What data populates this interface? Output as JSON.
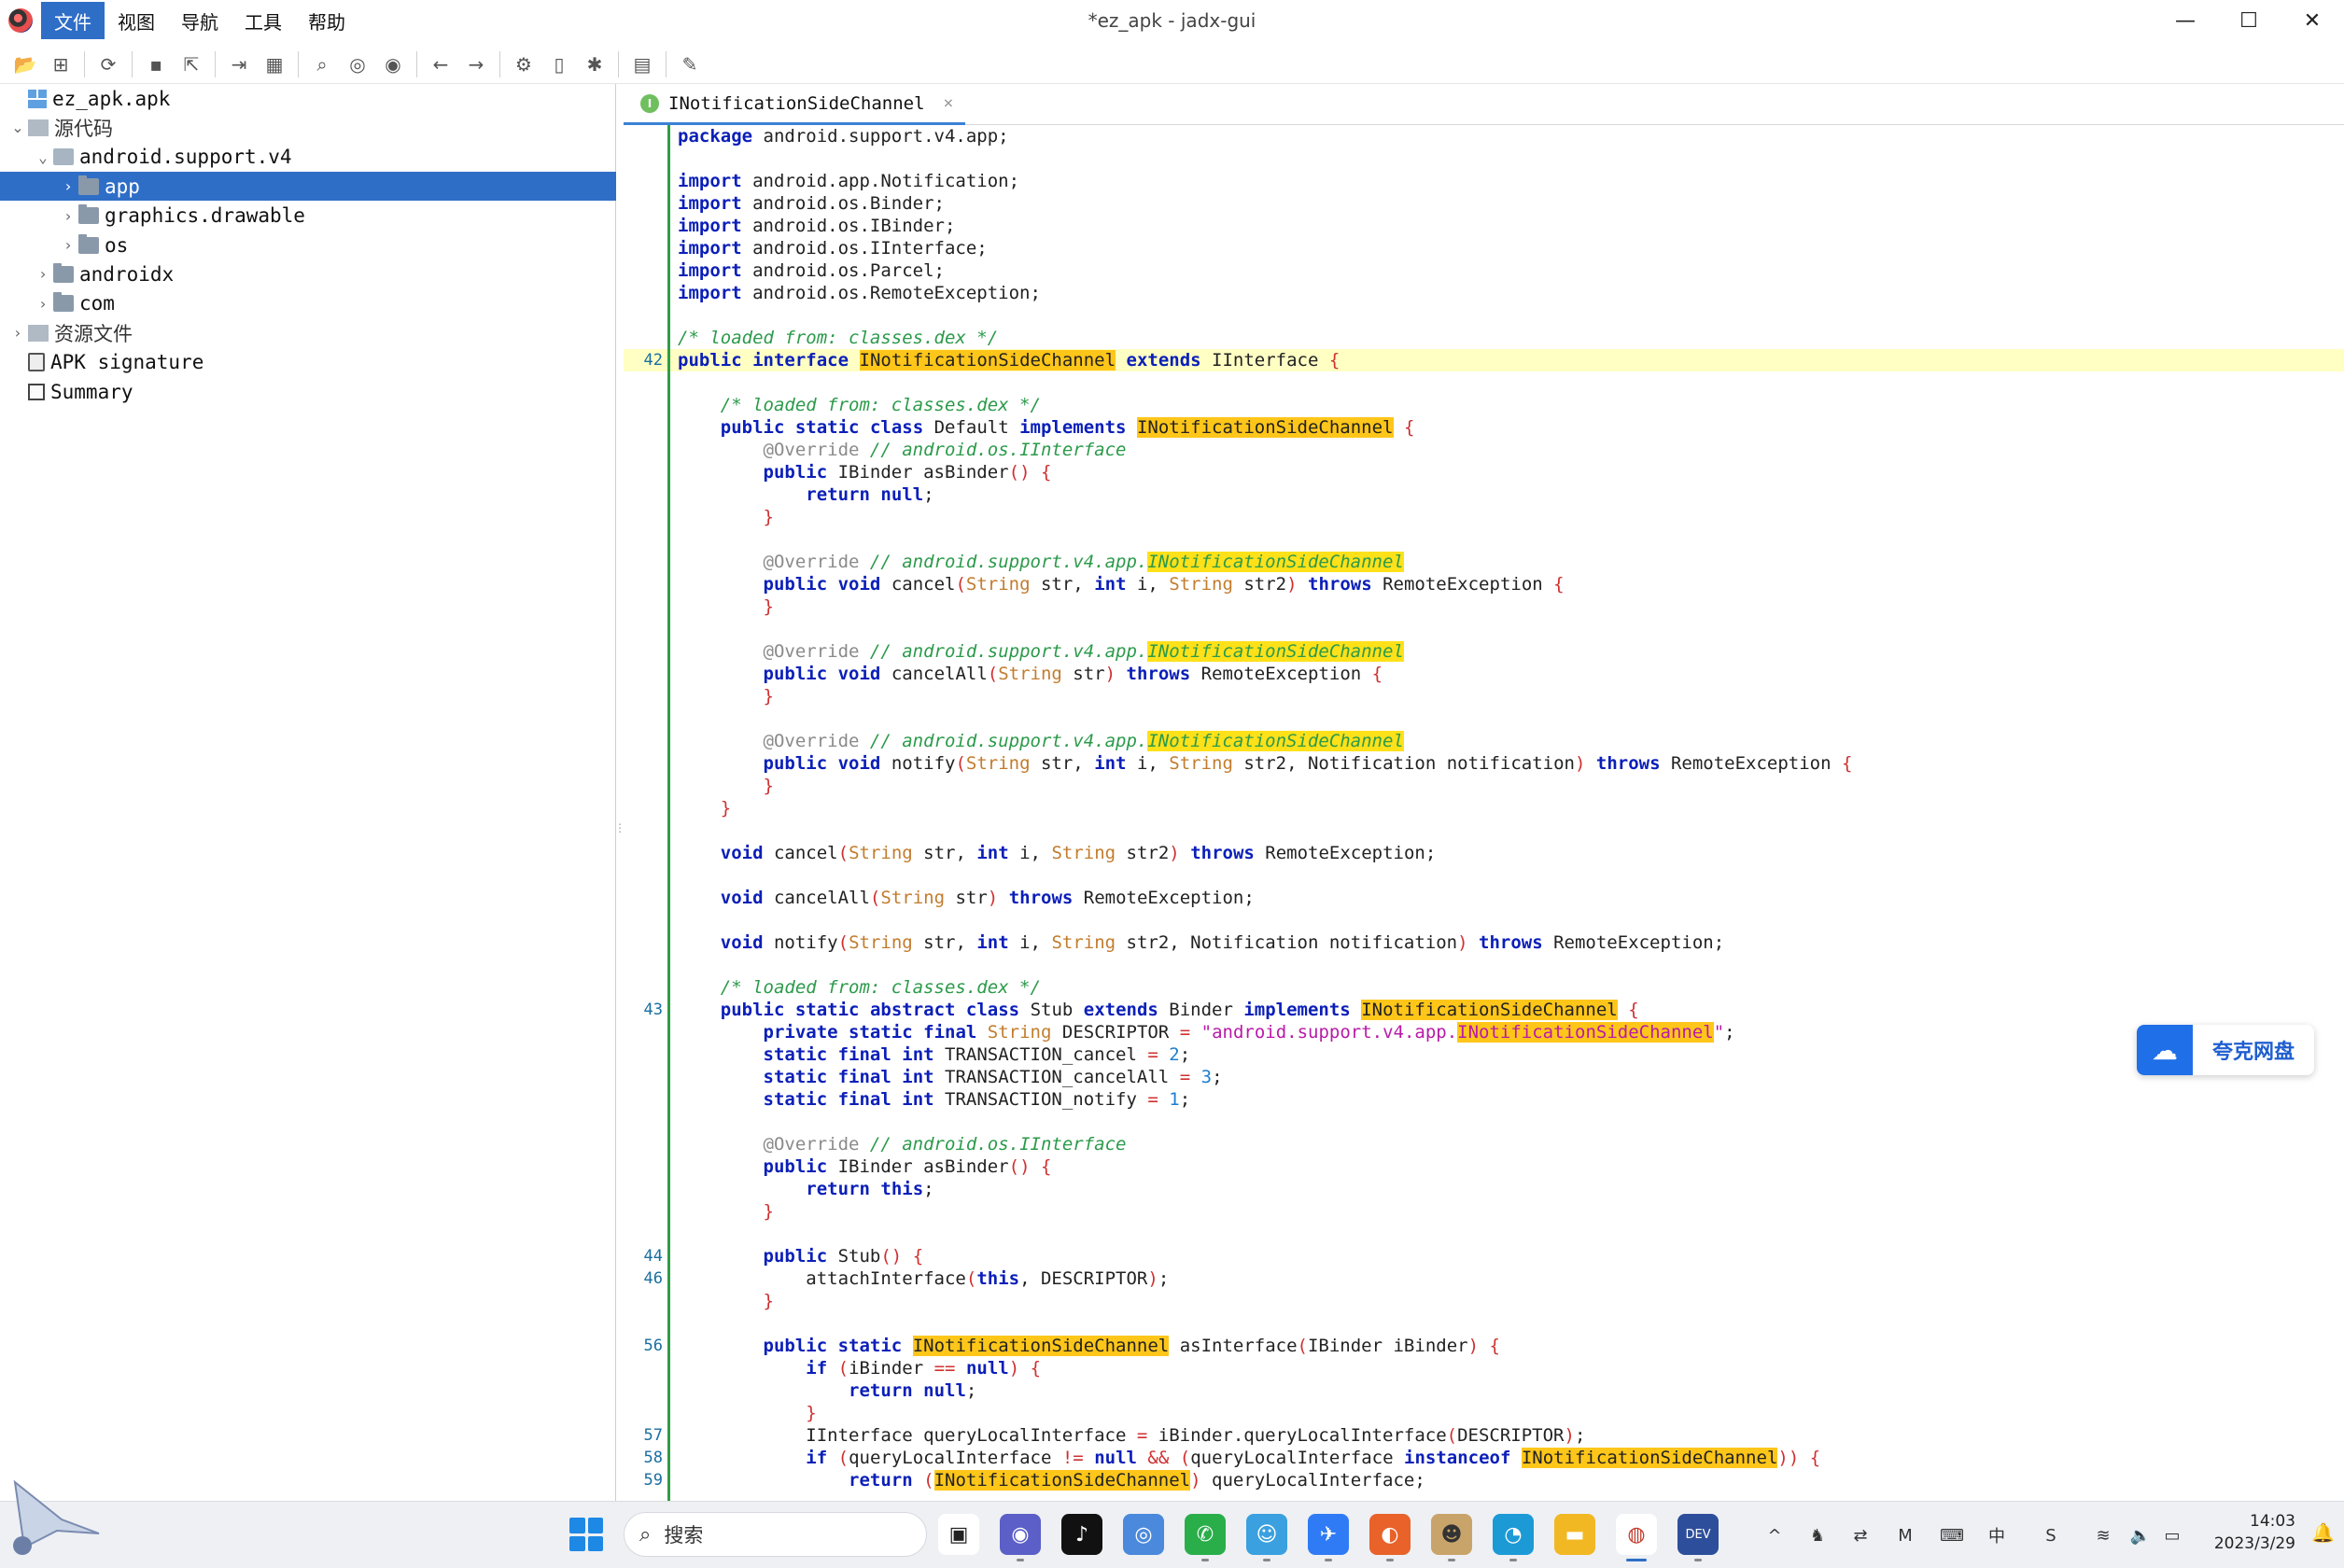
{
  "window": {
    "title": "*ez_apk - jadx-gui",
    "minimize": "—",
    "maximize": "☐",
    "close": "✕"
  },
  "menu": [
    "文件",
    "视图",
    "导航",
    "工具",
    "帮助"
  ],
  "toolbar": {
    "icons": [
      "open-file-icon",
      "add-files-icon",
      "reload-icon",
      "save-icon",
      "export-icon",
      "sync-icon",
      "flatten-icon",
      "search-icon",
      "find-class-icon",
      "find-usage-icon",
      "back-icon",
      "forward-icon",
      "deobfuscation-icon",
      "bookmark-icon",
      "debug-icon",
      "log-icon",
      "settings-icon"
    ]
  },
  "tree": [
    {
      "label": "ez_apk.apk",
      "indent": 0,
      "arrow": "",
      "icon": "apk",
      "selected": false
    },
    {
      "label": "源代码",
      "indent": 0,
      "arrow": "⌄",
      "icon": "box",
      "selected": false,
      "cjk": true
    },
    {
      "label": "android.support.v4",
      "indent": 1,
      "arrow": "⌄",
      "icon": "pkg",
      "selected": false
    },
    {
      "label": "app",
      "indent": 2,
      "arrow": "›",
      "icon": "folder",
      "selected": true
    },
    {
      "label": "graphics.drawable",
      "indent": 2,
      "arrow": "›",
      "icon": "folder",
      "selected": false
    },
    {
      "label": "os",
      "indent": 2,
      "arrow": "›",
      "icon": "folder",
      "selected": false
    },
    {
      "label": "androidx",
      "indent": 1,
      "arrow": "›",
      "icon": "folder",
      "selected": false
    },
    {
      "label": "com",
      "indent": 1,
      "arrow": "›",
      "icon": "folder",
      "selected": false
    },
    {
      "label": "资源文件",
      "indent": 0,
      "arrow": "›",
      "icon": "box",
      "selected": false,
      "cjk": true
    },
    {
      "label": "APK signature",
      "indent": 0,
      "arrow": "",
      "icon": "sig",
      "selected": false
    },
    {
      "label": "Summary",
      "indent": 0,
      "arrow": "",
      "icon": "sum",
      "selected": false
    }
  ],
  "editor": {
    "tab_label": "INotificationSideChannel",
    "tab_badge": "I",
    "tab_close": "×",
    "code_lines": [
      {
        "n": "",
        "html": "<span class='k'>package</span> android.support.v4.app;"
      },
      {
        "n": "",
        "html": ""
      },
      {
        "n": "",
        "html": "<span class='k'>import</span> android.app.Notification;"
      },
      {
        "n": "",
        "html": "<span class='k'>import</span> android.os.Binder;"
      },
      {
        "n": "",
        "html": "<span class='k'>import</span> android.os.IBinder;"
      },
      {
        "n": "",
        "html": "<span class='k'>import</span> android.os.IInterface;"
      },
      {
        "n": "",
        "html": "<span class='k'>import</span> android.os.Parcel;"
      },
      {
        "n": "",
        "html": "<span class='k'>import</span> android.os.RemoteException;"
      },
      {
        "n": "",
        "html": ""
      },
      {
        "n": "",
        "html": "<span class='c'>/* loaded from: classes.dex */</span>"
      },
      {
        "n": "42",
        "hl": true,
        "html": "<span class='k'>public</span> <span class='k'>interface</span> <span class='h'>INotificationSideChannel</span> <span class='k'>extends</span> IInterface <span class='p'>{</span>"
      },
      {
        "n": "",
        "html": ""
      },
      {
        "n": "",
        "html": "    <span class='c'>/* loaded from: classes.dex */</span>"
      },
      {
        "n": "",
        "html": "    <span class='k'>public</span> <span class='k'>static</span> <span class='k'>class</span> Default <span class='k'>implements</span> <span class='h'>INotificationSideChannel</span> <span class='p'>{</span>"
      },
      {
        "n": "",
        "html": "        <span class='a'>@Override</span> <span class='c'>// android.os.IInterface</span>"
      },
      {
        "n": "",
        "html": "        <span class='k'>public</span> IBinder asBinder<span class='p'>()</span> <span class='p'>{</span>"
      },
      {
        "n": "",
        "html": "            <span class='k'>return</span> <span class='k'>null</span>;"
      },
      {
        "n": "",
        "html": "        <span class='p'>}</span>"
      },
      {
        "n": "",
        "html": ""
      },
      {
        "n": "",
        "html": "        <span class='a'>@Override</span> <span class='c'>// android.support.v4.app.<span class='hc'>INotificationSideChannel</span></span>"
      },
      {
        "n": "",
        "html": "        <span class='k'>public</span> <span class='k'>void</span> cancel<span class='p'>(</span><span class='t'>String</span> str, <span class='k'>int</span> i, <span class='t'>String</span> str2<span class='p'>)</span> <span class='k'>throws</span> RemoteException <span class='p'>{</span>"
      },
      {
        "n": "",
        "html": "        <span class='p'>}</span>"
      },
      {
        "n": "",
        "html": ""
      },
      {
        "n": "",
        "html": "        <span class='a'>@Override</span> <span class='c'>// android.support.v4.app.<span class='hc'>INotificationSideChannel</span></span>"
      },
      {
        "n": "",
        "html": "        <span class='k'>public</span> <span class='k'>void</span> cancelAll<span class='p'>(</span><span class='t'>String</span> str<span class='p'>)</span> <span class='k'>throws</span> RemoteException <span class='p'>{</span>"
      },
      {
        "n": "",
        "html": "        <span class='p'>}</span>"
      },
      {
        "n": "",
        "html": ""
      },
      {
        "n": "",
        "html": "        <span class='a'>@Override</span> <span class='c'>// android.support.v4.app.<span class='hc'>INotificationSideChannel</span></span>"
      },
      {
        "n": "",
        "html": "        <span class='k'>public</span> <span class='k'>void</span> notify<span class='p'>(</span><span class='t'>String</span> str, <span class='k'>int</span> i, <span class='t'>String</span> str2, Notification notification<span class='p'>)</span> <span class='k'>throws</span> RemoteException <span class='p'>{</span>"
      },
      {
        "n": "",
        "html": "        <span class='p'>}</span>"
      },
      {
        "n": "",
        "html": "    <span class='p'>}</span>"
      },
      {
        "n": "",
        "html": ""
      },
      {
        "n": "",
        "html": "    <span class='k'>void</span> cancel<span class='p'>(</span><span class='t'>String</span> str, <span class='k'>int</span> i, <span class='t'>String</span> str2<span class='p'>)</span> <span class='k'>throws</span> RemoteException;"
      },
      {
        "n": "",
        "html": ""
      },
      {
        "n": "",
        "html": "    <span class='k'>void</span> cancelAll<span class='p'>(</span><span class='t'>String</span> str<span class='p'>)</span> <span class='k'>throws</span> RemoteException;"
      },
      {
        "n": "",
        "html": ""
      },
      {
        "n": "",
        "html": "    <span class='k'>void</span> notify<span class='p'>(</span><span class='t'>String</span> str, <span class='k'>int</span> i, <span class='t'>String</span> str2, Notification notification<span class='p'>)</span> <span class='k'>throws</span> RemoteException;"
      },
      {
        "n": "",
        "html": ""
      },
      {
        "n": "",
        "html": "    <span class='c'>/* loaded from: classes.dex */</span>"
      },
      {
        "n": "43",
        "html": "    <span class='k'>public</span> <span class='k'>static</span> <span class='k'>abstract</span> <span class='k'>class</span> Stub <span class='k'>extends</span> Binder <span class='k'>implements</span> <span class='h'>INotificationSideChannel</span> <span class='p'>{</span>"
      },
      {
        "n": "",
        "html": "        <span class='k'>private</span> <span class='k'>static</span> <span class='k'>final</span> <span class='t'>String</span> DESCRIPTOR <span class='p'>=</span> <span class='s'>\"android.support.v4.app.<span class='h'>INotificationSideChannel</span>\"</span>;"
      },
      {
        "n": "",
        "html": "        <span class='k'>static</span> <span class='k'>final</span> <span class='k'>int</span> TRANSACTION_cancel <span class='p'>=</span> <span class='n'>2</span>;"
      },
      {
        "n": "",
        "html": "        <span class='k'>static</span> <span class='k'>final</span> <span class='k'>int</span> TRANSACTION_cancelAll <span class='p'>=</span> <span class='n'>3</span>;"
      },
      {
        "n": "",
        "html": "        <span class='k'>static</span> <span class='k'>final</span> <span class='k'>int</span> TRANSACTION_notify <span class='p'>=</span> <span class='n'>1</span>;"
      },
      {
        "n": "",
        "html": ""
      },
      {
        "n": "",
        "html": "        <span class='a'>@Override</span> <span class='c'>// android.os.IInterface</span>"
      },
      {
        "n": "",
        "html": "        <span class='k'>public</span> IBinder asBinder<span class='p'>()</span> <span class='p'>{</span>"
      },
      {
        "n": "",
        "html": "            <span class='k'>return</span> <span class='k'>this</span>;"
      },
      {
        "n": "",
        "html": "        <span class='p'>}</span>"
      },
      {
        "n": "",
        "html": ""
      },
      {
        "n": "44",
        "html": "        <span class='k'>public</span> Stub<span class='p'>()</span> <span class='p'>{</span>"
      },
      {
        "n": "46",
        "html": "            attachInterface<span class='p'>(</span><span class='k'>this</span>, DESCRIPTOR<span class='p'>)</span>;"
      },
      {
        "n": "",
        "html": "        <span class='p'>}</span>"
      },
      {
        "n": "",
        "html": ""
      },
      {
        "n": "56",
        "html": "        <span class='k'>public</span> <span class='k'>static</span> <span class='h'>INotificationSideChannel</span> asInterface<span class='p'>(</span>IBinder iBinder<span class='p'>)</span> <span class='p'>{</span>"
      },
      {
        "n": "",
        "html": "            <span class='k'>if</span> <span class='p'>(</span>iBinder <span class='p'>==</span> <span class='k'>null</span><span class='p'>)</span> <span class='p'>{</span>"
      },
      {
        "n": "",
        "html": "                <span class='k'>return</span> <span class='k'>null</span>;"
      },
      {
        "n": "",
        "html": "            <span class='p'>}</span>"
      },
      {
        "n": "57",
        "html": "            IInterface queryLocalInterface <span class='p'>=</span> iBinder.queryLocalInterface<span class='p'>(</span>DESCRIPTOR<span class='p'>)</span>;"
      },
      {
        "n": "58",
        "html": "            <span class='k'>if</span> <span class='p'>(</span>queryLocalInterface <span class='p'>!=</span> <span class='k'>null</span> <span class='p'>&amp;&amp;</span> <span class='p'>(</span>queryLocalInterface <span class='k'>instanceof</span> <span class='h'>INotificationSideChannel</span><span class='p'>))</span> <span class='p'>{</span>"
      },
      {
        "n": "59",
        "html": "                <span class='k'>return</span> <span class='p'>(</span><span class='h'>INotificationSideChannel</span><span class='p'>)</span> queryLocalInterface;"
      }
    ]
  },
  "quark": {
    "label": "夸克网盘",
    "icon": "cloud-icon"
  },
  "taskbar": {
    "search_placeholder": "搜索",
    "apps": [
      {
        "name": "task-view-icon",
        "glyph": "▣",
        "bg": "#ffffff",
        "fg": "#222"
      },
      {
        "name": "chat-icon",
        "glyph": "◉",
        "bg": "#5b5fc7",
        "fg": "#fff"
      },
      {
        "name": "tiktok-icon",
        "glyph": "♪",
        "bg": "#111111",
        "fg": "#fff"
      },
      {
        "name": "chrome-icon",
        "glyph": "◎",
        "bg": "#4a89dc",
        "fg": "#fff"
      },
      {
        "name": "wechat-icon",
        "glyph": "✆",
        "bg": "#2aae4a",
        "fg": "#fff"
      },
      {
        "name": "qq-panda-icon",
        "glyph": "☺",
        "bg": "#3aa0e0",
        "fg": "#fff"
      },
      {
        "name": "feishu-icon",
        "glyph": "✈",
        "bg": "#2f7bf5",
        "fg": "#fff"
      },
      {
        "name": "firefox-icon",
        "glyph": "◐",
        "bg": "#e8622a",
        "fg": "#fff"
      },
      {
        "name": "avatar-app-icon",
        "glyph": "☻",
        "bg": "#c9a46a",
        "fg": "#333"
      },
      {
        "name": "edge-icon",
        "glyph": "◔",
        "bg": "#1b9ad6",
        "fg": "#fff"
      },
      {
        "name": "file-explorer-icon",
        "glyph": "▬",
        "bg": "#f2b824",
        "fg": "#fff"
      },
      {
        "name": "jadx-icon",
        "glyph": "◍",
        "bg": "#ffffff",
        "fg": "#c0392b"
      },
      {
        "name": "devcpp-icon",
        "glyph": "DEV",
        "bg": "#2d4e9a",
        "fg": "#fff"
      }
    ],
    "tray": [
      {
        "name": "show-hidden-icon",
        "glyph": "^"
      },
      {
        "name": "qq-tray-icon",
        "glyph": "♞"
      },
      {
        "name": "sliders-icon",
        "glyph": "⇄"
      },
      {
        "name": "ime-icon",
        "glyph": "M"
      },
      {
        "name": "keyboard-icon",
        "glyph": "⌨"
      },
      {
        "name": "input-lang-icon",
        "glyph": "中"
      },
      {
        "name": "wps-icon",
        "glyph": "S"
      },
      {
        "name": "wifi-icon",
        "glyph": "≋"
      },
      {
        "name": "volume-icon",
        "glyph": "🔈"
      },
      {
        "name": "battery-icon",
        "glyph": "▭"
      }
    ],
    "time": "14:03",
    "date": "2023/3/29"
  }
}
